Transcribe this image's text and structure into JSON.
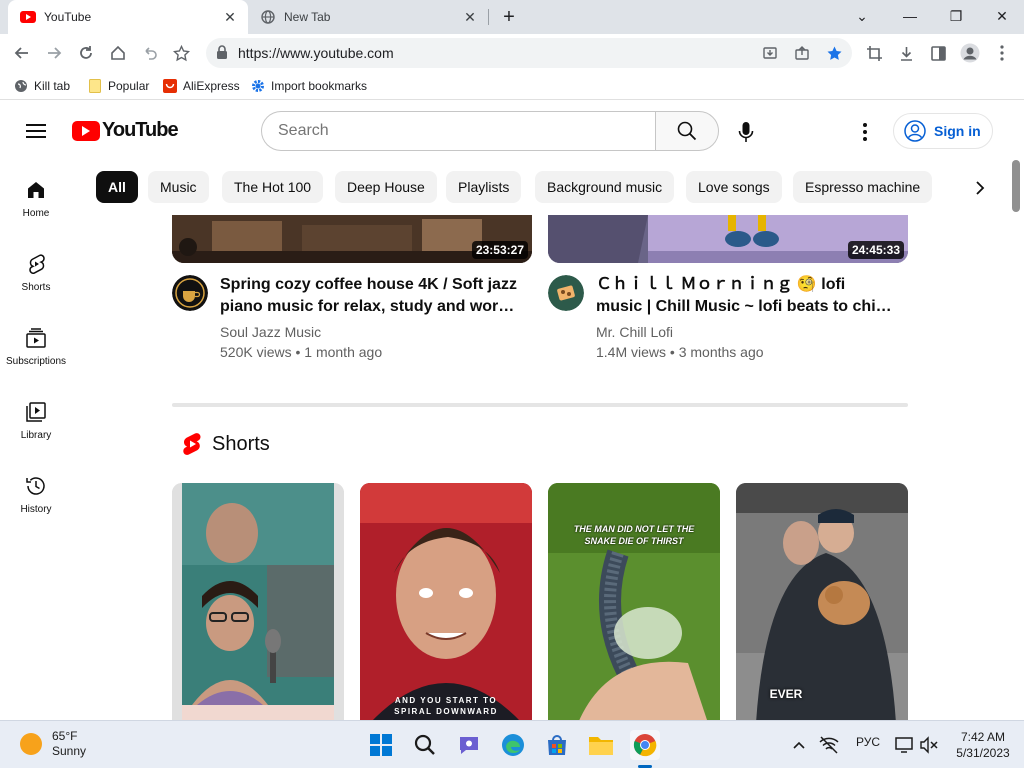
{
  "browser": {
    "tabs": [
      {
        "title": "YouTube",
        "active": true
      },
      {
        "title": "New Tab",
        "active": false
      }
    ],
    "url": "https://www.youtube.com",
    "bookmarks": [
      "Kill tab",
      "Popular",
      "AliExpress",
      "Import bookmarks"
    ]
  },
  "youtube": {
    "brand_color": "#ff0000",
    "logo_text": "YouTube",
    "search_placeholder": "Search",
    "sign_in": "Sign in",
    "chips": [
      "All",
      "Music",
      "The Hot 100",
      "Deep House",
      "Playlists",
      "Background music",
      "Love songs",
      "Espresso machine"
    ],
    "sidebar": [
      {
        "label": "Home",
        "icon": "home-icon"
      },
      {
        "label": "Shorts",
        "icon": "shorts-icon"
      },
      {
        "label": "Subscriptions",
        "icon": "subscriptions-icon"
      },
      {
        "label": "Library",
        "icon": "library-icon"
      },
      {
        "label": "History",
        "icon": "history-icon"
      }
    ],
    "videos": [
      {
        "title_line1": "Spring cozy coffee house 4K / Soft jazz",
        "title_line2": "piano music for relax, study and work...",
        "channel": "Soul Jazz Music",
        "meta": "520K views • 1 month ago",
        "duration": "23:53:27"
      },
      {
        "title_line1": "Ｃｈｉｌｌ Ｍｏｒｎｉｎｇ 🧐 lofi",
        "title_line2": "music | Chill Music ~ lofi beats to chill ...",
        "channel": "Mr. Chill Lofi",
        "meta": "1.4M views • 3 months ago",
        "duration": "24:45:33"
      }
    ],
    "shorts_title": "Shorts",
    "shorts_captions": [
      "",
      "AND YOU START TO SPIRAL DOWNWARD",
      "THE MAN DID NOT LET THE SNAKE DIE OF THIRST",
      "EVER"
    ]
  },
  "taskbar": {
    "weather_temp": "65°F",
    "weather_desc": "Sunny",
    "lang": "РУС",
    "time": "7:42 AM",
    "date": "5/31/2023"
  }
}
